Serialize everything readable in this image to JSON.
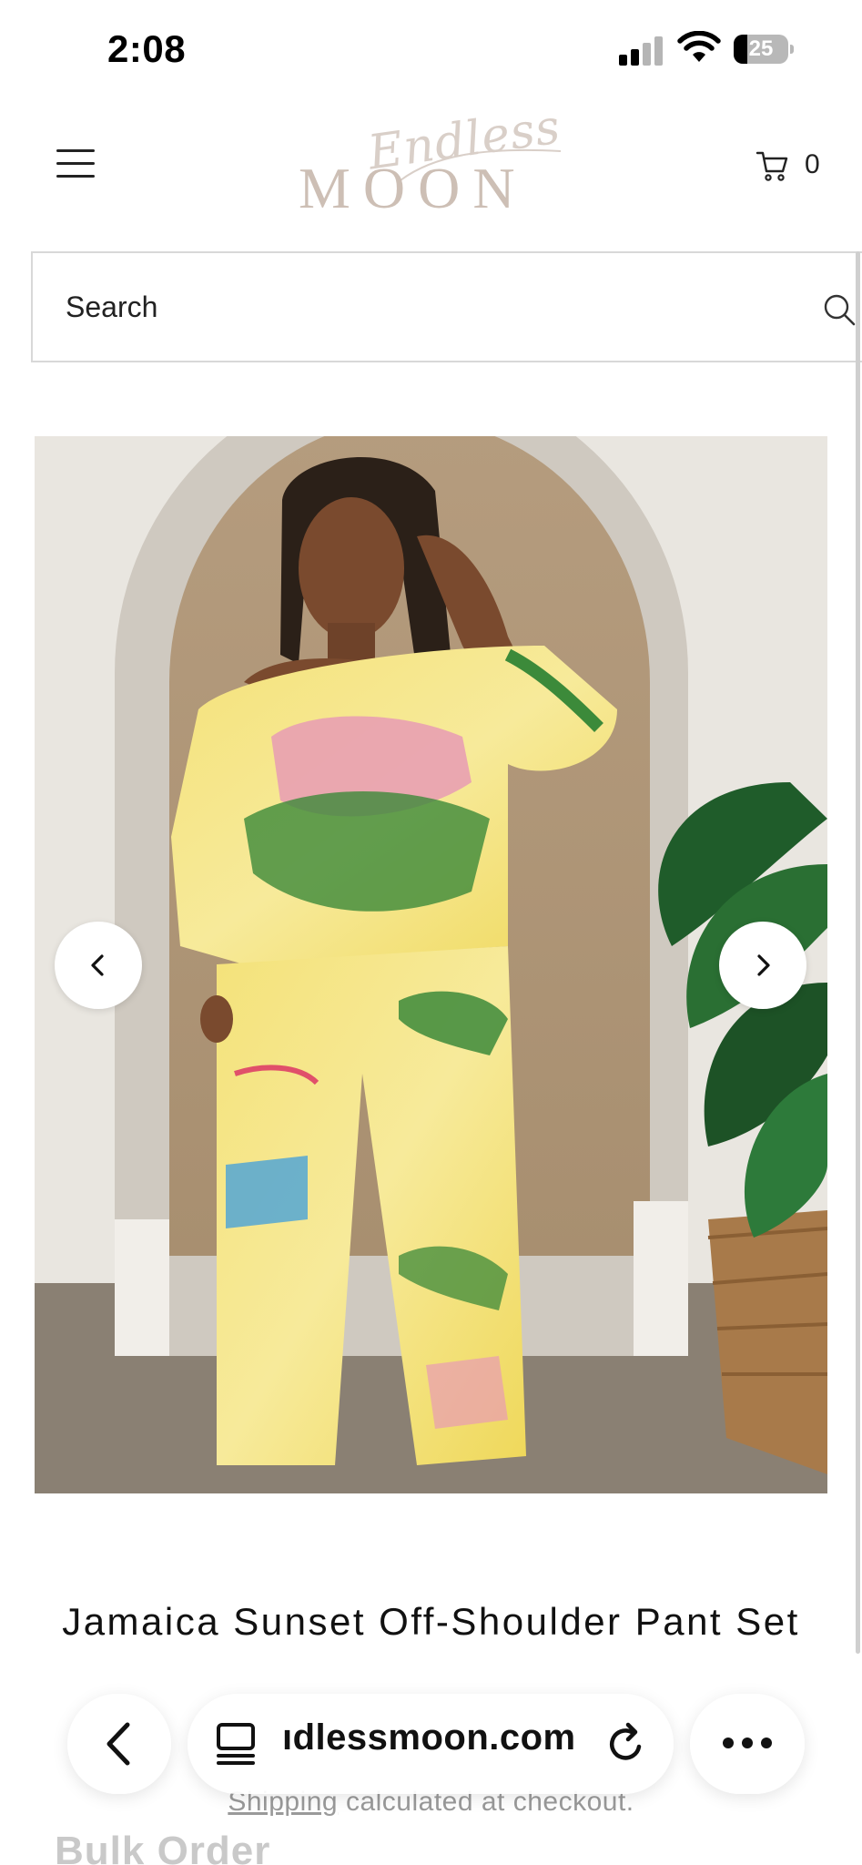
{
  "status_bar": {
    "time": "2:08",
    "battery": "25",
    "battery_fraction": 0.25
  },
  "header": {
    "logo_script": "Endless",
    "logo_main": "MOON",
    "cart_count": "0"
  },
  "search": {
    "placeholder": "Search"
  },
  "product": {
    "title": "Jamaica Sunset Off-Shoulder Pant Set",
    "shipping_link": "Shipping",
    "shipping_rest": " calculated at checkout.",
    "bulk_order": "Bulk Order"
  },
  "browser": {
    "url": "endlessmoon.com",
    "url_visible": "ıdlessmoon.com"
  },
  "icons": {
    "menu": "hamburger-menu-icon",
    "cart": "cart-icon",
    "search": "search-icon",
    "prev": "chevron-left-icon",
    "next": "chevron-right-icon",
    "back": "back-arrow-icon",
    "reader": "reader-mode-icon",
    "reload": "reload-icon",
    "more": "more-dots-icon"
  },
  "colors": {
    "logo": "#cdbfb5",
    "muted_text": "#9a9a9a",
    "border": "#d8d8d8"
  }
}
